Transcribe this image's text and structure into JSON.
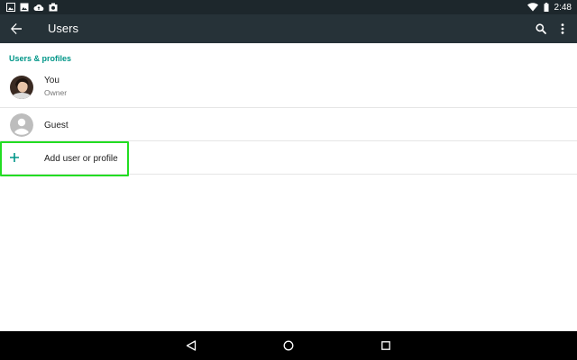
{
  "status_bar": {
    "time": "2:48",
    "left_icons": [
      "image-icon",
      "gallery-icon",
      "cloud-upload-icon",
      "camera-icon"
    ],
    "right_icons": [
      "wifi-icon",
      "battery-icon"
    ]
  },
  "app_bar": {
    "title": "Users",
    "back_icon": "arrow-back-icon",
    "actions": [
      "search-icon",
      "more-vert-icon"
    ],
    "background": "#263238"
  },
  "section": {
    "header": "Users & profiles",
    "accent": "#009688"
  },
  "users": [
    {
      "name": "You",
      "role": "Owner",
      "avatar": "user-photo"
    },
    {
      "name": "Guest",
      "avatar": "guest-avatar-icon"
    }
  ],
  "add_item": {
    "label": "Add user or profile",
    "icon": "plus-icon"
  },
  "highlight": {
    "color": "#22dd22",
    "target": "add-user-or-profile"
  },
  "nav_bar": {
    "buttons": [
      "nav-back-icon",
      "nav-home-icon",
      "nav-recents-icon"
    ]
  }
}
